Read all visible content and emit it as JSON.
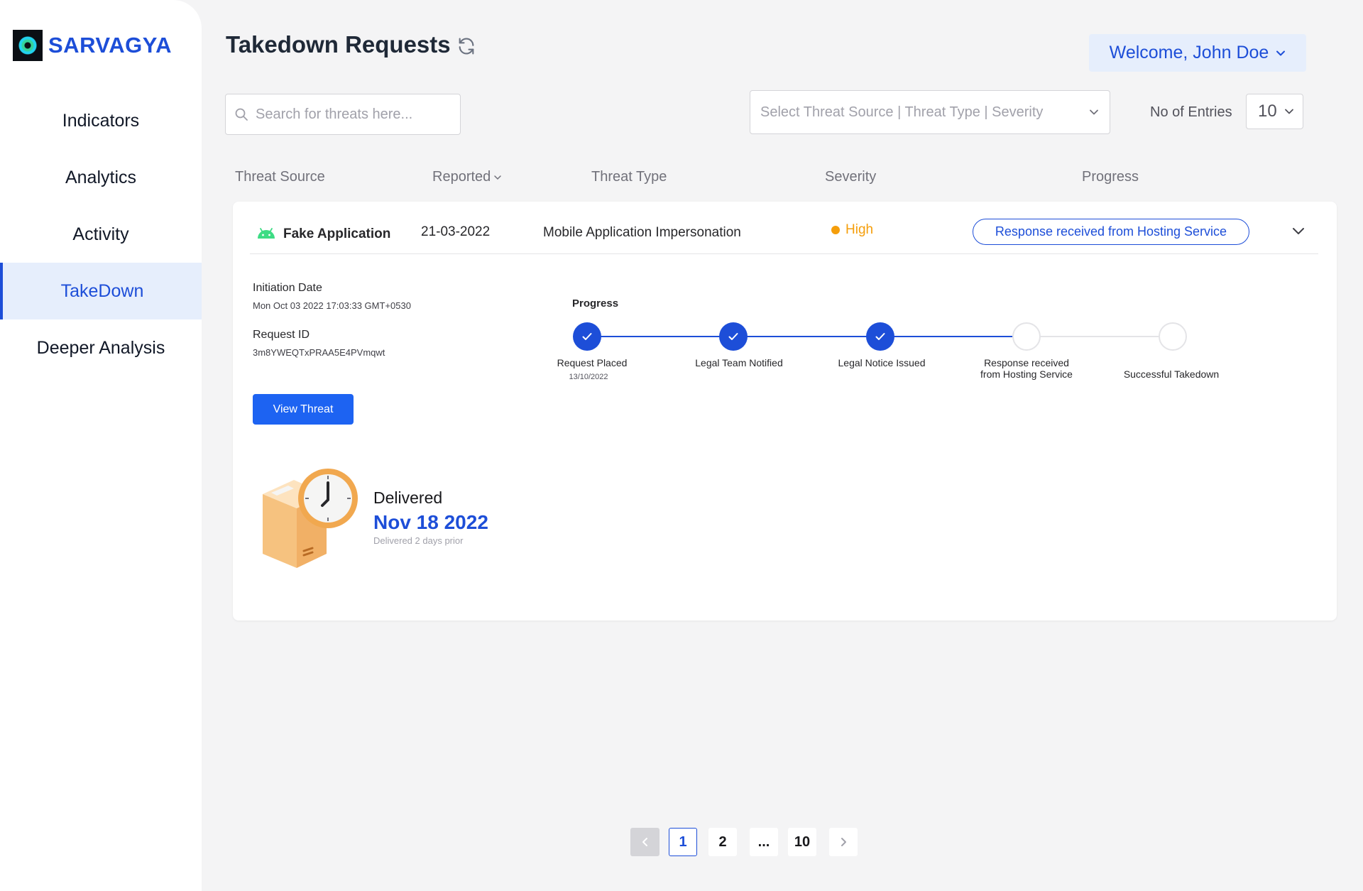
{
  "brand": {
    "name": "SARVAGYA"
  },
  "sidebar": {
    "items": [
      {
        "label": "Indicators"
      },
      {
        "label": "Analytics"
      },
      {
        "label": "Activity"
      },
      {
        "label": "TakeDown"
      },
      {
        "label": "Deeper Analysis"
      }
    ],
    "active": "TakeDown"
  },
  "header": {
    "title": "Takedown Requests",
    "welcome": "Welcome, John Doe"
  },
  "filters": {
    "search_placeholder": "Search for threats here...",
    "select_placeholder": "Select Threat Source |  Threat Type | Severity",
    "entries_label": "No of Entries",
    "entries_value": "10"
  },
  "table": {
    "columns": [
      "Threat Source",
      "Reported",
      "Threat Type",
      "Severity",
      "Progress"
    ],
    "rows": [
      {
        "source": "Fake Application",
        "reported": "21-03-2022",
        "type": "Mobile Application Impersonation",
        "severity": "High",
        "status": "Response received from Hosting Service",
        "details": {
          "initiation_label": "Initiation Date",
          "initiation_value": "Mon Oct 03 2022 17:03:33 GMT+0530",
          "request_label": "Request ID",
          "request_value": "3m8YWEQTxPRAA5E4PVmqwt",
          "view_button": "View Threat",
          "progress_title": "Progress",
          "steps": [
            {
              "label_1": "Request Placed",
              "label_2": "",
              "date": "13/10/2022",
              "done": true
            },
            {
              "label_1": "Legal Team Notified",
              "label_2": "",
              "date": "",
              "done": true
            },
            {
              "label_1": "Legal Notice Issued",
              "label_2": "",
              "date": "",
              "done": true
            },
            {
              "label_1": "Response received",
              "label_2": "from Hosting Service",
              "date": "",
              "done": false
            },
            {
              "label_1": "Successful Takedown",
              "label_2": "",
              "date": "",
              "done": false
            }
          ],
          "delivered_label": "Delivered",
          "delivered_date": "Nov 18 2022",
          "delivered_note": "Delivered 2 days prior"
        }
      }
    ]
  },
  "pagination": {
    "pages": [
      "1",
      "2",
      "...",
      "10"
    ],
    "current": "1"
  },
  "colors": {
    "accent": "#1d4ed8",
    "severity_high": "#f59e0b",
    "active_nav_bg": "#e6eefc"
  },
  "icons": [
    "refresh-icon",
    "chevron-down-icon",
    "search-icon",
    "android-icon",
    "check-icon",
    "chevron-left-icon",
    "chevron-right-icon",
    "delivery-box-clock-icon"
  ]
}
